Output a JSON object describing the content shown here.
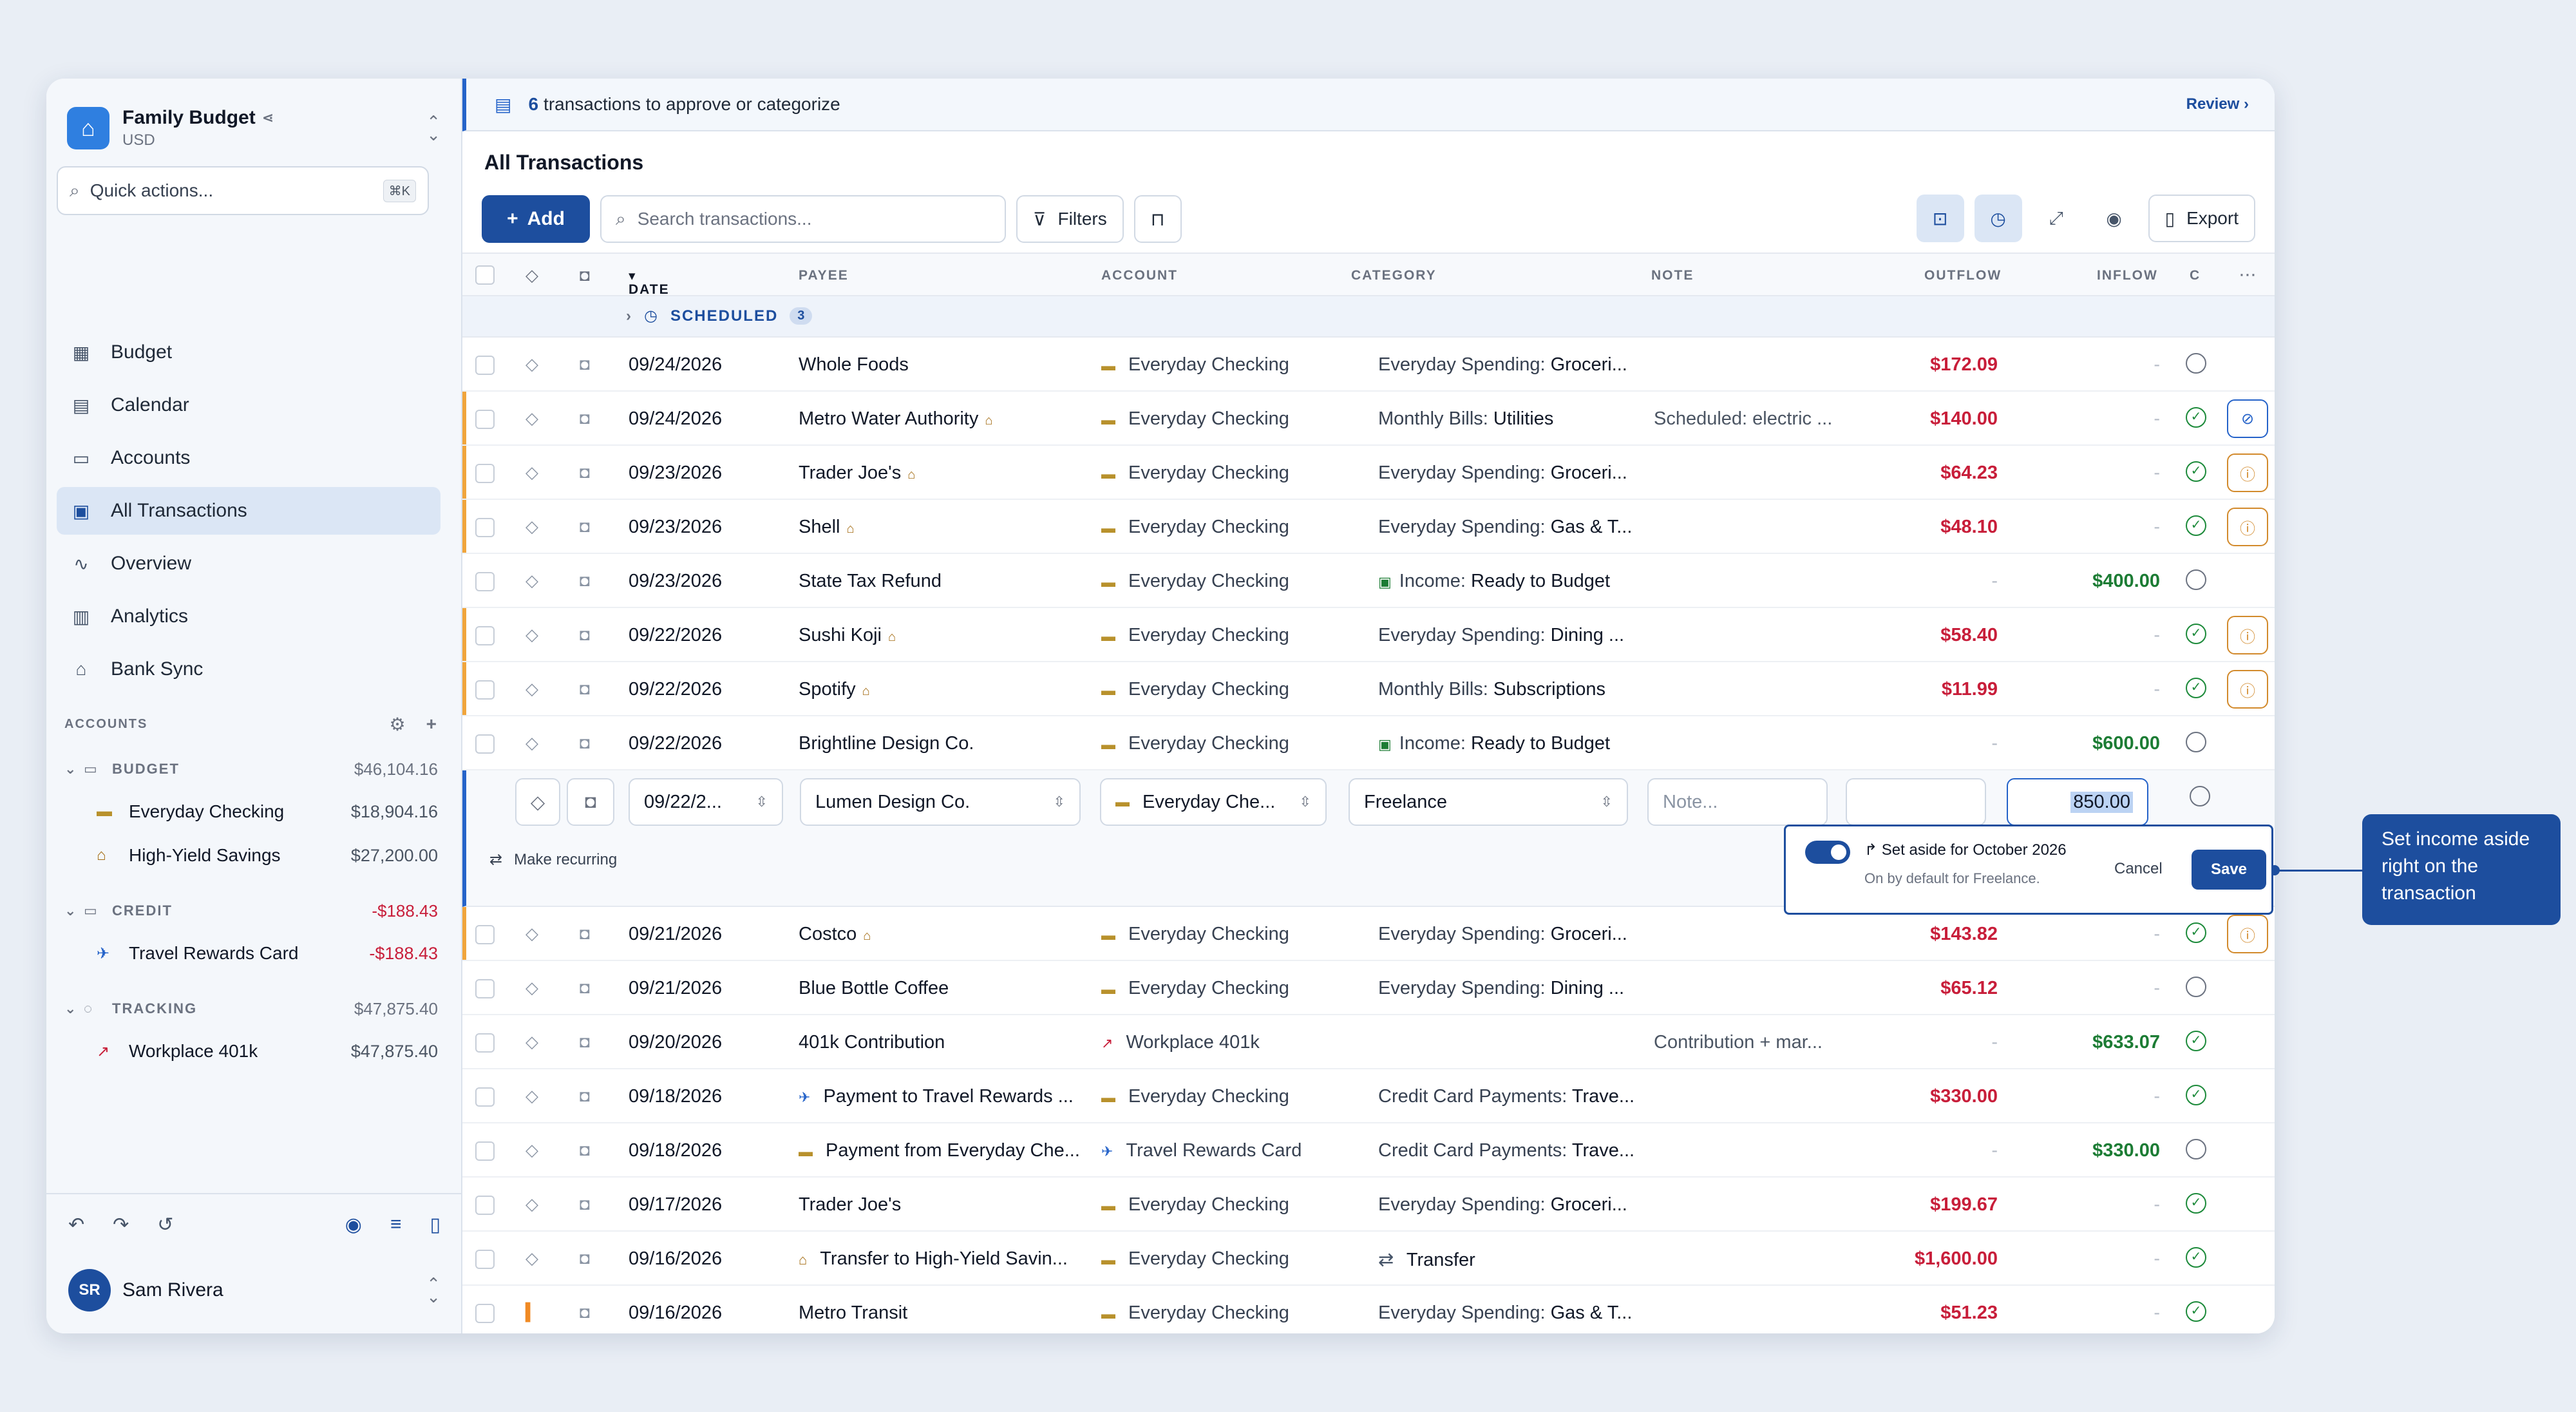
{
  "sidebar": {
    "budget_name": "Family Budget",
    "currency": "USD",
    "quick_actions": "Quick actions...",
    "quick_kbd": "⌘K",
    "nav": [
      {
        "label": "Budget",
        "icon": "grid-icon"
      },
      {
        "label": "Calendar",
        "icon": "calendar-icon"
      },
      {
        "label": "Accounts",
        "icon": "folder-icon"
      },
      {
        "label": "All Transactions",
        "icon": "transactions-icon"
      },
      {
        "label": "Overview",
        "icon": "pulse-icon"
      },
      {
        "label": "Analytics",
        "icon": "bar-chart-icon"
      },
      {
        "label": "Bank Sync",
        "icon": "bank-icon"
      }
    ],
    "accounts_heading": "ACCOUNTS",
    "groups": [
      {
        "name": "BUDGET",
        "amount": "$46,104.16",
        "accounts": [
          {
            "name": "Everyday Checking",
            "amount": "$18,904.16"
          },
          {
            "name": "High-Yield Savings",
            "amount": "$27,200.00"
          }
        ]
      },
      {
        "name": "CREDIT",
        "amount": "-$188.43",
        "accounts": [
          {
            "name": "Travel Rewards Card",
            "amount": "-$188.43"
          }
        ]
      },
      {
        "name": "TRACKING",
        "amount": "$47,875.40",
        "accounts": [
          {
            "name": "Workplace 401k",
            "amount": "$47,875.40"
          }
        ]
      }
    ],
    "user_initials": "SR",
    "user_name": "Sam Rivera"
  },
  "banner": {
    "count": "6",
    "text": "transactions to approve or categorize",
    "action": "Review"
  },
  "page_title": "All Transactions",
  "toolbar": {
    "add": "Add",
    "search_placeholder": "Search transactions...",
    "filters": "Filters",
    "export": "Export"
  },
  "columns": {
    "date": "DATE",
    "payee": "PAYEE",
    "account": "ACCOUNT",
    "category": "CATEGORY",
    "note": "NOTE",
    "outflow": "OUTFLOW",
    "inflow": "INFLOW",
    "cleared": "C"
  },
  "scheduled": {
    "label": "SCHEDULED",
    "count": "3"
  },
  "rows_top": [
    {
      "date": "09/24/2026",
      "payee": "Whole Foods",
      "account": "Everyday Checking",
      "cat_group": "Everyday Spending:",
      "cat": "Groceri...",
      "note": "",
      "out": "$172.09",
      "in": "-",
      "cleared": false,
      "flag": false,
      "bank": false,
      "action": ""
    },
    {
      "date": "09/24/2026",
      "payee": "Metro Water Authority",
      "account": "Everyday Checking",
      "cat_group": "Monthly Bills:",
      "cat": "Utilities",
      "note": "Scheduled: electric ...",
      "out": "$140.00",
      "in": "-",
      "cleared": true,
      "flag": true,
      "bank": true,
      "action": "link"
    },
    {
      "date": "09/23/2026",
      "payee": "Trader Joe's",
      "account": "Everyday Checking",
      "cat_group": "Everyday Spending:",
      "cat": "Groceri...",
      "note": "",
      "out": "$64.23",
      "in": "-",
      "cleared": true,
      "flag": true,
      "bank": true,
      "action": "info"
    },
    {
      "date": "09/23/2026",
      "payee": "Shell",
      "account": "Everyday Checking",
      "cat_group": "Everyday Spending:",
      "cat": "Gas & T...",
      "note": "",
      "out": "$48.10",
      "in": "-",
      "cleared": true,
      "flag": true,
      "bank": true,
      "action": "info"
    },
    {
      "date": "09/23/2026",
      "payee": "State Tax Refund",
      "account": "Everyday Checking",
      "cat_group": "Income:",
      "cat": "Ready to Budget",
      "note": "",
      "out": "-",
      "in": "$400.00",
      "cleared": false,
      "flag": false,
      "bank": false,
      "action": "",
      "income": true
    },
    {
      "date": "09/22/2026",
      "payee": "Sushi Koji",
      "account": "Everyday Checking",
      "cat_group": "Everyday Spending:",
      "cat": "Dining ...",
      "note": "",
      "out": "$58.40",
      "in": "-",
      "cleared": true,
      "flag": true,
      "bank": true,
      "action": "info"
    },
    {
      "date": "09/22/2026",
      "payee": "Spotify",
      "account": "Everyday Checking",
      "cat_group": "Monthly Bills:",
      "cat": "Subscriptions",
      "note": "",
      "out": "$11.99",
      "in": "-",
      "cleared": true,
      "flag": true,
      "bank": true,
      "action": "info"
    },
    {
      "date": "09/22/2026",
      "payee": "Brightline Design Co.",
      "account": "Everyday Checking",
      "cat_group": "Income:",
      "cat": "Ready to Budget",
      "note": "",
      "out": "-",
      "in": "$600.00",
      "cleared": false,
      "flag": false,
      "bank": false,
      "action": "",
      "income": true
    }
  ],
  "edit_row": {
    "date": "09/22/2...",
    "payee": "Lumen Design Co.",
    "account": "Everyday Che...",
    "category": "Freelance",
    "note_placeholder": "Note...",
    "inflow": "850.00",
    "make_recurring": "Make recurring"
  },
  "popup": {
    "title": "Set aside for October 2026",
    "subtitle": "On by default for Freelance.",
    "cancel": "Cancel",
    "save": "Save"
  },
  "rows_bottom": [
    {
      "date": "09/21/2026",
      "payee": "Costco",
      "account": "Everyday Checking",
      "cat_group": "Everyday Spending:",
      "cat": "Groceri...",
      "note": "",
      "out": "$143.82",
      "in": "-",
      "cleared": true,
      "flag": true,
      "bank": true,
      "action": "info"
    },
    {
      "date": "09/21/2026",
      "payee": "Blue Bottle Coffee",
      "account": "Everyday Checking",
      "cat_group": "Everyday Spending:",
      "cat": "Dining ...",
      "note": "",
      "out": "$65.12",
      "in": "-",
      "cleared": false,
      "flag": false,
      "bank": false,
      "action": ""
    },
    {
      "date": "09/20/2026",
      "payee": "401k Contribution",
      "account": "Workplace 401k",
      "cat_group": "",
      "cat": "",
      "note": "Contribution + mar...",
      "out": "-",
      "in": "$633.07",
      "cleared": true,
      "flag": false,
      "bank": false,
      "action": "",
      "acct_chart": true
    },
    {
      "date": "09/18/2026",
      "payee": "Payment to Travel Rewards ...",
      "account": "Everyday Checking",
      "cat_group": "Credit Card Payments:",
      "cat": "Trave...",
      "note": "",
      "out": "$330.00",
      "in": "-",
      "cleared": true,
      "flag": false,
      "bank": false,
      "action": "",
      "payee_plane": true
    },
    {
      "date": "09/18/2026",
      "payee": "Payment from Everyday Che...",
      "account": "Travel Rewards Card",
      "cat_group": "Credit Card Payments:",
      "cat": "Trave...",
      "note": "",
      "out": "-",
      "in": "$330.00",
      "cleared": false,
      "flag": false,
      "bank": false,
      "action": "",
      "payee_card": true,
      "acct_plane": true
    },
    {
      "date": "09/17/2026",
      "payee": "Trader Joe's",
      "account": "Everyday Checking",
      "cat_group": "Everyday Spending:",
      "cat": "Groceri...",
      "note": "",
      "out": "$199.67",
      "in": "-",
      "cleared": true,
      "flag": false,
      "bank": false,
      "action": ""
    },
    {
      "date": "09/16/2026",
      "payee": "Transfer to High-Yield Savin...",
      "account": "Everyday Checking",
      "cat_group": "",
      "cat": "Transfer",
      "note": "",
      "out": "$1,600.00",
      "in": "-",
      "cleared": true,
      "flag": false,
      "bank": false,
      "action": "",
      "payee_bank": true,
      "transfer": true
    },
    {
      "date": "09/16/2026",
      "payee": "Metro Transit",
      "account": "Everyday Checking",
      "cat_group": "Everyday Spending:",
      "cat": "Gas & T...",
      "note": "",
      "out": "$51.23",
      "in": "-",
      "cleared": true,
      "flag": false,
      "bank": false,
      "action": "",
      "tag_flag": true
    }
  ],
  "callout": "Set income aside right on the transaction",
  "colors": {
    "primary": "#1d4e9e",
    "outflow": "#c81e3a",
    "inflow": "#1c7c34",
    "flag": "#f0a53c"
  }
}
